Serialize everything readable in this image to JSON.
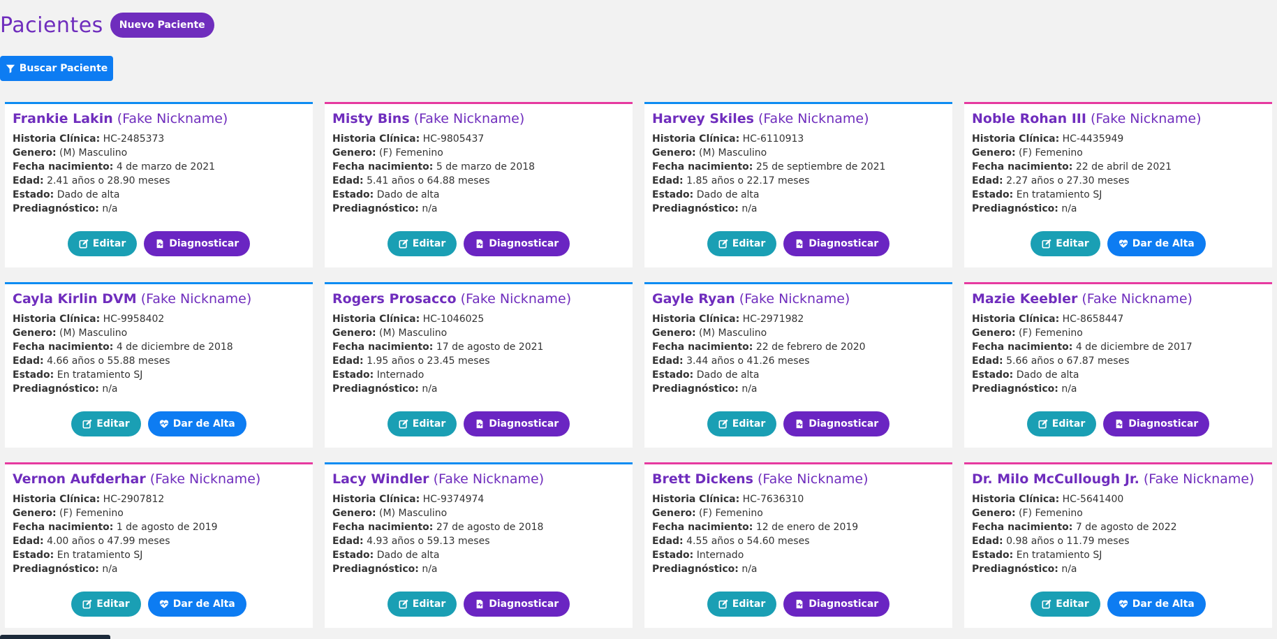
{
  "page": {
    "title": "Pacientes",
    "new_patient_label": "Nuevo Paciente",
    "search_label": "Buscar Paciente"
  },
  "labels": {
    "historia": "Historia Clínica:",
    "genero": "Genero:",
    "fecha": "Fecha nacimiento:",
    "edad": "Edad:",
    "estado": "Estado:",
    "prediag": "Prediagnóstico:",
    "edit": "Editar",
    "diagnose": "Diagnosticar",
    "discharge": "Dar de Alta"
  },
  "colors": {
    "purple": "#6f2dbd",
    "male_border": "#0d8cf2",
    "female_border": "#e63aa0",
    "edit_button": "#1a9fb4",
    "diagnose_button": "#6a25c2",
    "discharge_button": "#0d7cf2"
  },
  "patients": [
    {
      "name": "Frankie Lakin",
      "nick": "(Fake Nickname)",
      "hc": "HC-2485373",
      "genero": "(M) Masculino",
      "fecha": "4 de marzo de 2021",
      "edad": "2.41 años o 28.90 meses",
      "estado": "Dado de alta",
      "prediag": "n/a",
      "sex": "M",
      "action": "diagnose"
    },
    {
      "name": "Misty Bins",
      "nick": "(Fake Nickname)",
      "hc": "HC-9805437",
      "genero": "(F) Femenino",
      "fecha": "5 de marzo de 2018",
      "edad": "5.41 años o 64.88 meses",
      "estado": "Dado de alta",
      "prediag": "n/a",
      "sex": "F",
      "action": "diagnose"
    },
    {
      "name": "Harvey Skiles",
      "nick": "(Fake Nickname)",
      "hc": "HC-6110913",
      "genero": "(M) Masculino",
      "fecha": "25 de septiembre de 2021",
      "edad": "1.85 años o 22.17 meses",
      "estado": "Dado de alta",
      "prediag": "n/a",
      "sex": "M",
      "action": "diagnose"
    },
    {
      "name": "Noble Rohan III",
      "nick": "(Fake Nickname)",
      "hc": "HC-4435949",
      "genero": "(F) Femenino",
      "fecha": "22 de abril de 2021",
      "edad": "2.27 años o 27.30 meses",
      "estado": "En tratamiento SJ",
      "prediag": "n/a",
      "sex": "F",
      "action": "discharge"
    },
    {
      "name": "Cayla Kirlin DVM",
      "nick": "(Fake Nickname)",
      "hc": "HC-9958402",
      "genero": "(M) Masculino",
      "fecha": "4 de diciembre de 2018",
      "edad": "4.66 años o 55.88 meses",
      "estado": "En tratamiento SJ",
      "prediag": "n/a",
      "sex": "M",
      "action": "discharge"
    },
    {
      "name": "Rogers Prosacco",
      "nick": "(Fake Nickname)",
      "hc": "HC-1046025",
      "genero": "(M) Masculino",
      "fecha": "17 de agosto de 2021",
      "edad": "1.95 años o 23.45 meses",
      "estado": "Internado",
      "prediag": "n/a",
      "sex": "M",
      "action": "diagnose"
    },
    {
      "name": "Gayle Ryan",
      "nick": "(Fake Nickname)",
      "hc": "HC-2971982",
      "genero": "(M) Masculino",
      "fecha": "22 de febrero de 2020",
      "edad": "3.44 años o 41.26 meses",
      "estado": "Dado de alta",
      "prediag": "n/a",
      "sex": "M",
      "action": "diagnose"
    },
    {
      "name": "Mazie Keebler",
      "nick": "(Fake Nickname)",
      "hc": "HC-8658447",
      "genero": "(F) Femenino",
      "fecha": "4 de diciembre de 2017",
      "edad": "5.66 años o 67.87 meses",
      "estado": "Dado de alta",
      "prediag": "n/a",
      "sex": "F",
      "action": "diagnose"
    },
    {
      "name": "Vernon Aufderhar",
      "nick": "(Fake Nickname)",
      "hc": "HC-2907812",
      "genero": "(F) Femenino",
      "fecha": "1 de agosto de 2019",
      "edad": "4.00 años o 47.99 meses",
      "estado": "En tratamiento SJ",
      "prediag": "n/a",
      "sex": "F",
      "action": "discharge"
    },
    {
      "name": "Lacy Windler",
      "nick": "(Fake Nickname)",
      "hc": "HC-9374974",
      "genero": "(M) Masculino",
      "fecha": "27 de agosto de 2018",
      "edad": "4.93 años o 59.13 meses",
      "estado": "Dado de alta",
      "prediag": "n/a",
      "sex": "M",
      "action": "diagnose"
    },
    {
      "name": "Brett Dickens",
      "nick": "(Fake Nickname)",
      "hc": "HC-7636310",
      "genero": "(F) Femenino",
      "fecha": "12 de enero de 2019",
      "edad": "4.55 años o 54.60 meses",
      "estado": "Internado",
      "prediag": "n/a",
      "sex": "F",
      "action": "diagnose"
    },
    {
      "name": "Dr. Milo McCullough Jr.",
      "nick": "(Fake Nickname)",
      "hc": "HC-5641400",
      "genero": "(F) Femenino",
      "fecha": "7 de agosto de 2022",
      "edad": "0.98 años o 11.79 meses",
      "estado": "En tratamiento SJ",
      "prediag": "n/a",
      "sex": "F",
      "action": "discharge"
    }
  ]
}
